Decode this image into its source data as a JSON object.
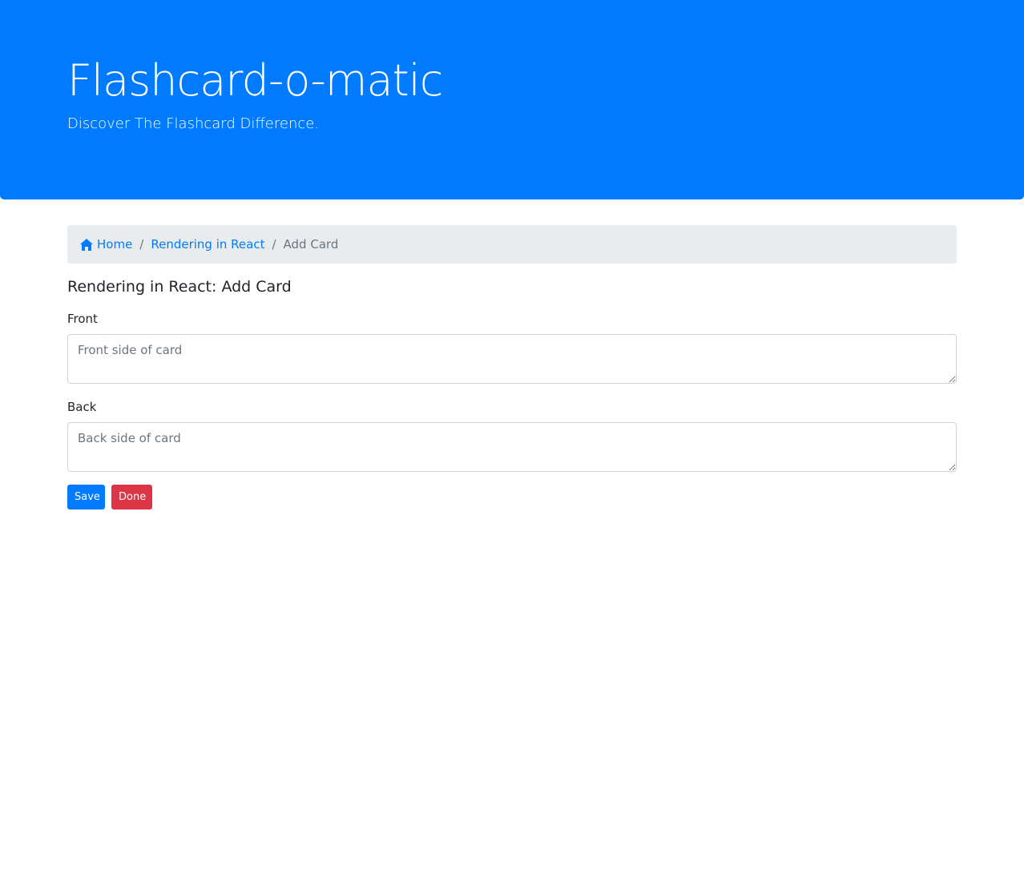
{
  "header": {
    "title": "Flashcard-o-matic",
    "lead": "Discover The Flashcard Difference."
  },
  "breadcrumb": {
    "home_label": "Home",
    "home_icon": "home-icon",
    "deck_label": "Rendering in React",
    "current_label": "Add Card",
    "separator": "/"
  },
  "form": {
    "title": "Rendering in React: Add Card",
    "front_label": "Front",
    "front_placeholder": "Front side of card",
    "front_value": "",
    "back_label": "Back",
    "back_placeholder": "Back side of card",
    "back_value": "",
    "save_label": "Save",
    "done_label": "Done"
  },
  "colors": {
    "primary": "#007bff",
    "danger": "#dc3545",
    "breadcrumb_bg": "#e9ecef"
  }
}
